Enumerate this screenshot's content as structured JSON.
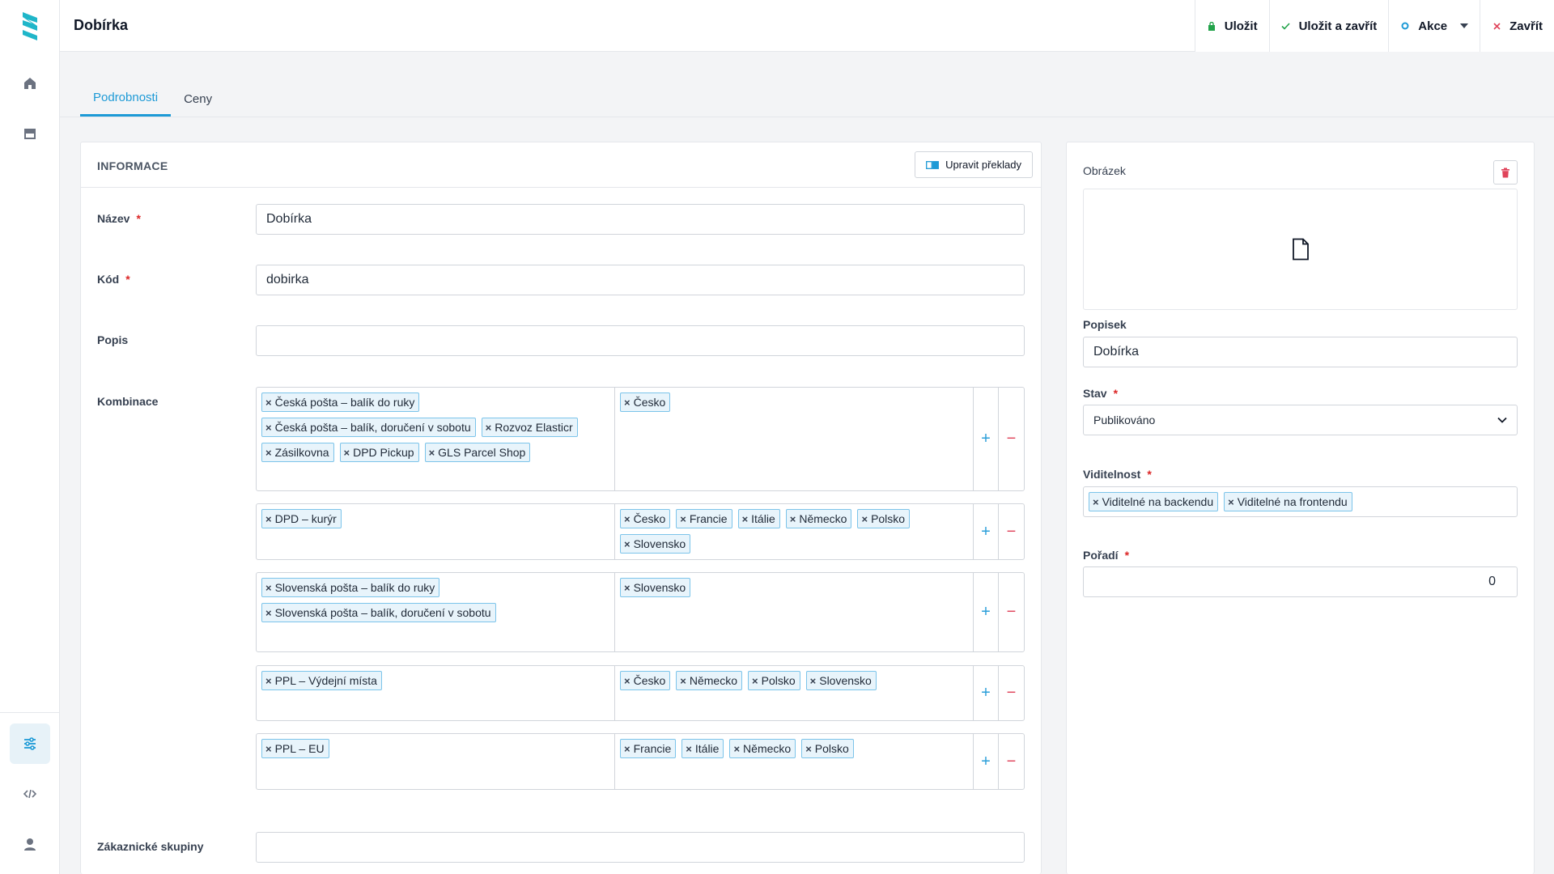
{
  "header": {
    "title": "Dobírka",
    "actions": {
      "save": "Uložit",
      "save_close": "Uložit a zavřít",
      "actions": "Akce",
      "close": "Zavřít"
    }
  },
  "tabs": [
    {
      "label": "Podrobnosti",
      "active": true
    },
    {
      "label": "Ceny",
      "active": false
    }
  ],
  "info": {
    "title": "INFORMACE",
    "translate_button": "Upravit překlady",
    "name_label": "Název",
    "name_value": "Dobírka",
    "code_label": "Kód",
    "code_value": "dobirka",
    "desc_label": "Popis",
    "desc_value": "",
    "combo_label": "Kombinace",
    "groups_label": "Zákaznické skupiny",
    "combinations": [
      {
        "carriers": [
          "Česká pošta – balík do ruky",
          "Česká pošta – balík, doručení v sobotu",
          "Rozvoz Elasticr",
          "Zásilkovna",
          "DPD Pickup",
          "GLS Parcel Shop"
        ],
        "countries": [
          "Česko"
        ]
      },
      {
        "carriers": [
          "DPD – kurýr"
        ],
        "countries": [
          "Česko",
          "Francie",
          "Itálie",
          "Německo",
          "Polsko",
          "Slovensko"
        ]
      },
      {
        "carriers": [
          "Slovenská pošta – balík do ruky",
          "Slovenská pošta – balík, doručení v sobotu"
        ],
        "countries": [
          "Slovensko"
        ]
      },
      {
        "carriers": [
          "PPL – Výdejní místa"
        ],
        "countries": [
          "Česko",
          "Německo",
          "Polsko",
          "Slovensko"
        ]
      },
      {
        "carriers": [
          "PPL – EU"
        ],
        "countries": [
          "Francie",
          "Itálie",
          "Německo",
          "Polsko"
        ]
      }
    ]
  },
  "side": {
    "image_label": "Obrázek",
    "caption_label": "Popisek",
    "caption_value": "Dobírka",
    "status_label": "Stav",
    "status_value": "Publikováno",
    "visibility_label": "Viditelnost",
    "visibility_tags": [
      "Viditelné na backendu",
      "Viditelné na frontendu"
    ],
    "order_label": "Pořadí",
    "order_value": "0"
  },
  "colors": {
    "accent": "#1d9ad6",
    "logo": "#1fb6c9",
    "danger": "#e0435a",
    "save_green": "#22a34a"
  }
}
